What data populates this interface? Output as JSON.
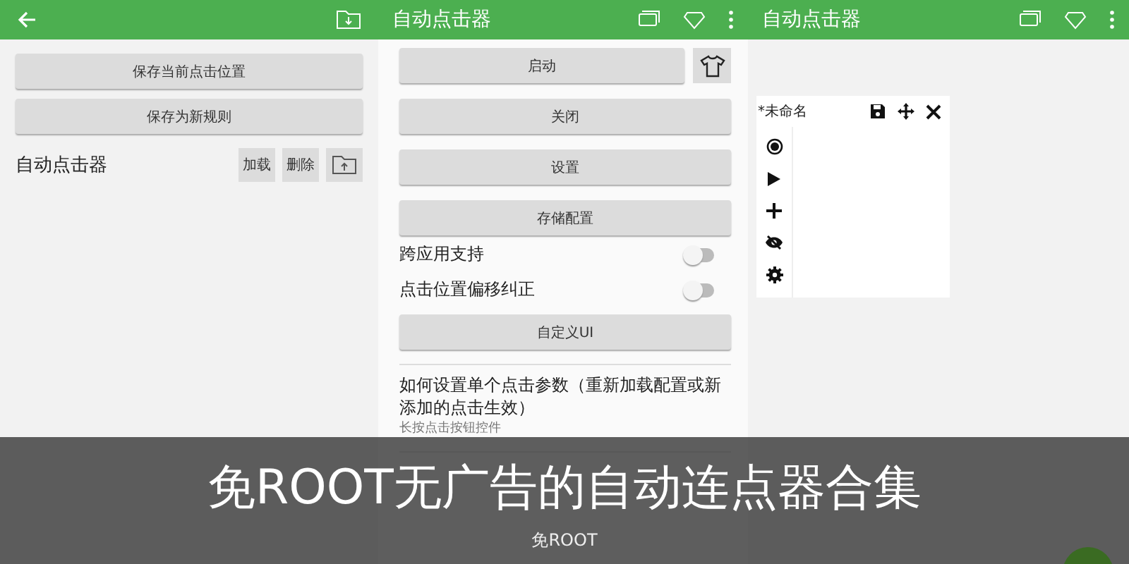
{
  "left_screen": {
    "buttons": [
      "保存当前点击位置",
      "保存为新规则"
    ],
    "rule": {
      "name": "自动点击器",
      "actions": [
        "加载",
        "删除"
      ]
    }
  },
  "middle_screen": {
    "title": "自动点击器",
    "start_button": "启动",
    "buttons": [
      "关闭",
      "设置",
      "存储配置"
    ],
    "toggles": [
      {
        "label": "跨应用支持",
        "on": false
      },
      {
        "label": "点击位置偏移纠正",
        "on": false
      }
    ],
    "custom_button": "自定义UI",
    "help": {
      "title": "如何设置单个点击参数（重新加载配置或新添加的点击生效）",
      "subtitle": "长按点击按钮控件"
    }
  },
  "right_screen": {
    "title": "自动点击器",
    "panel_title": "*未命名"
  },
  "caption": {
    "title": "免ROOT无广告的自动连点器合集",
    "subtitle": "免ROOT"
  }
}
